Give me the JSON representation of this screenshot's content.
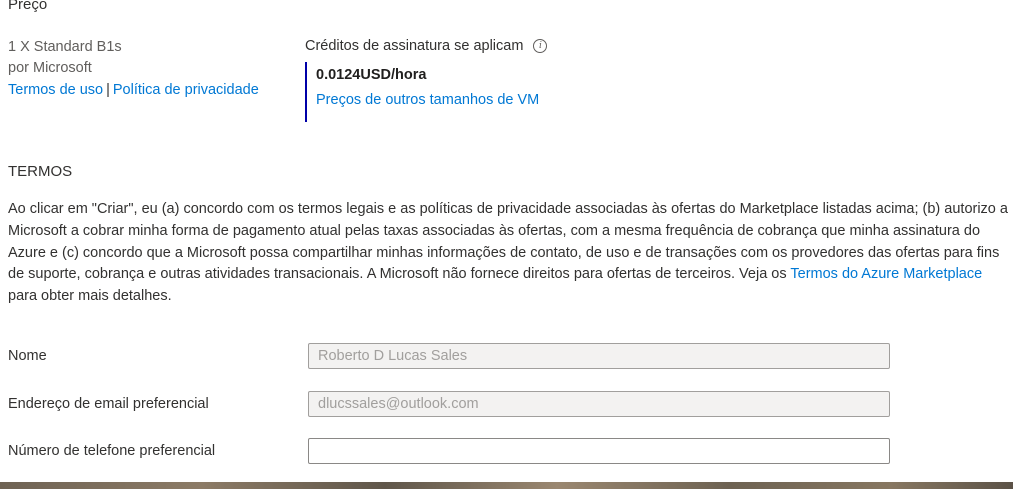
{
  "pricing": {
    "heading": "Preço",
    "product": "1 X Standard B1s",
    "publisher": "por Microsoft",
    "terms_link": "Termos de uso",
    "separator": "|",
    "privacy_link": "Política de privacidade",
    "credits_text": "Créditos de assinatura se aplicam",
    "info_icon": "info-icon",
    "price": "0.0124USD/hora",
    "other_sizes_link": "Preços de outros tamanhos de VM"
  },
  "terms": {
    "heading": "TERMOS",
    "body_before_link": "Ao clicar em \"Criar\", eu (a) concordo com os termos legais e as políticas de privacidade associadas às ofertas do Marketplace listadas acima; (b) autorizo a Microsoft a cobrar minha forma de pagamento atual pelas taxas associadas às ofertas, com a mesma frequência de cobrança que minha assinatura do Azure e (c) concordo que a Microsoft possa compartilhar minhas informações de contato, de uso e de transações com os provedores das ofertas para fins de suporte, cobrança e outras atividades transacionais. A Microsoft não fornece direitos para ofertas de terceiros. Veja os ",
    "link": "Termos do Azure Marketplace",
    "body_after_link": " para obter mais detalhes."
  },
  "form": {
    "name_label": "Nome",
    "name_value": "Roberto D Lucas Sales",
    "email_label": "Endereço de email preferencial",
    "email_value": "dlucssales@outlook.com",
    "phone_label": "Número de telefone preferencial",
    "phone_value": ""
  },
  "colors": {
    "link": "#0078d4",
    "price_accent_border": "#0000a8",
    "disabled_input_bg": "#f3f2f1"
  }
}
